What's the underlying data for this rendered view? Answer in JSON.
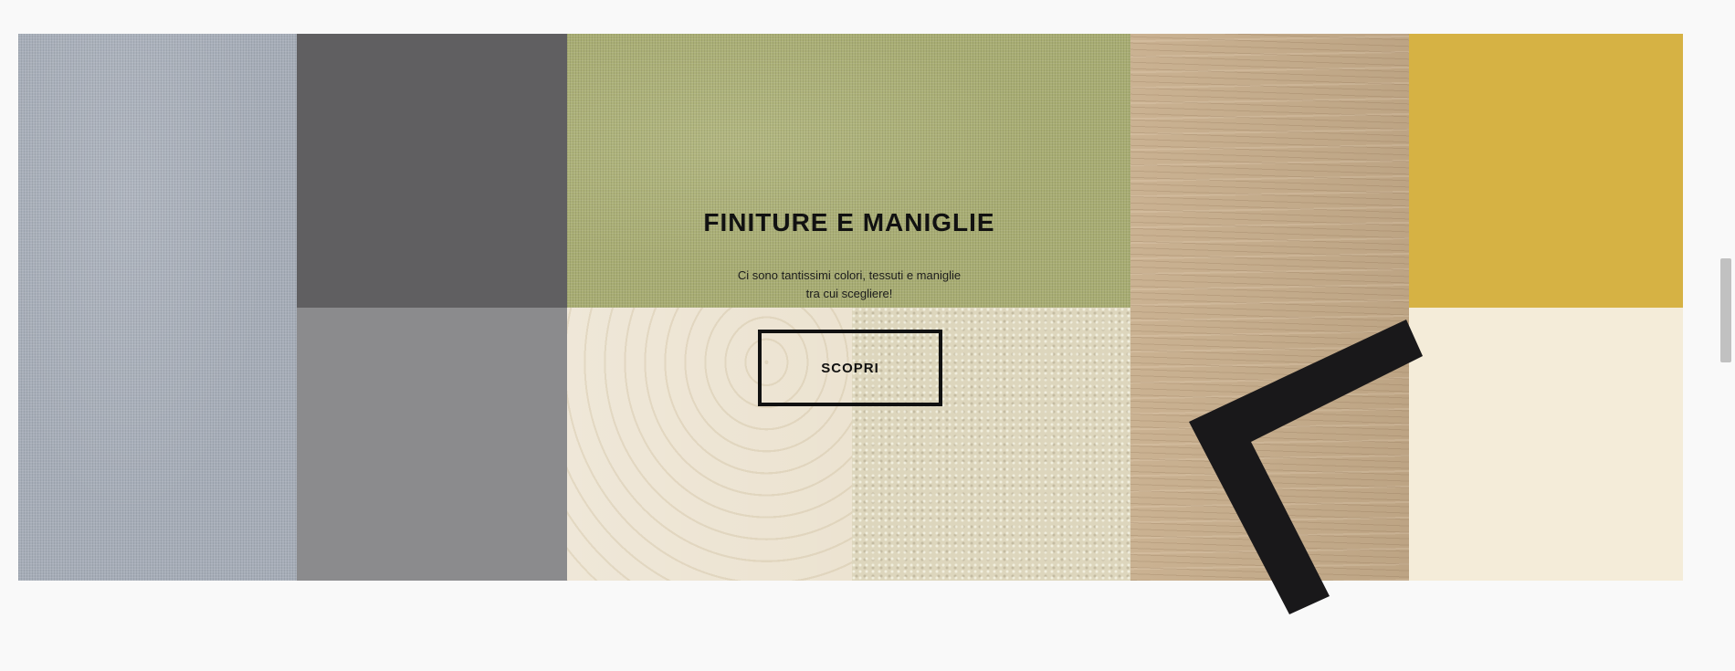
{
  "section": {
    "title": "FINITURE E MANIGLIE",
    "subtitle_line1": "Ci sono tantissimi colori, tessuti e maniglie",
    "subtitle_line2": "tra cui scegliere!",
    "cta_label": "SCOPRI"
  },
  "swatches": [
    {
      "name": "grey-fabric",
      "color": "#a6adb8"
    },
    {
      "name": "dark-grey",
      "color": "#605f61"
    },
    {
      "name": "mid-grey",
      "color": "#8b8b8d"
    },
    {
      "name": "olive-fabric",
      "color": "#a8ad73"
    },
    {
      "name": "birch-wood",
      "color": "#ece3d1"
    },
    {
      "name": "linen-fabric",
      "color": "#ddd6bd"
    },
    {
      "name": "oak-wood",
      "color": "#c7ad8b"
    },
    {
      "name": "mustard",
      "color": "#d6b244"
    },
    {
      "name": "cream",
      "color": "#f4ecd9"
    }
  ],
  "handle": {
    "icon": "angle-handle-icon",
    "color": "#19181a"
  }
}
